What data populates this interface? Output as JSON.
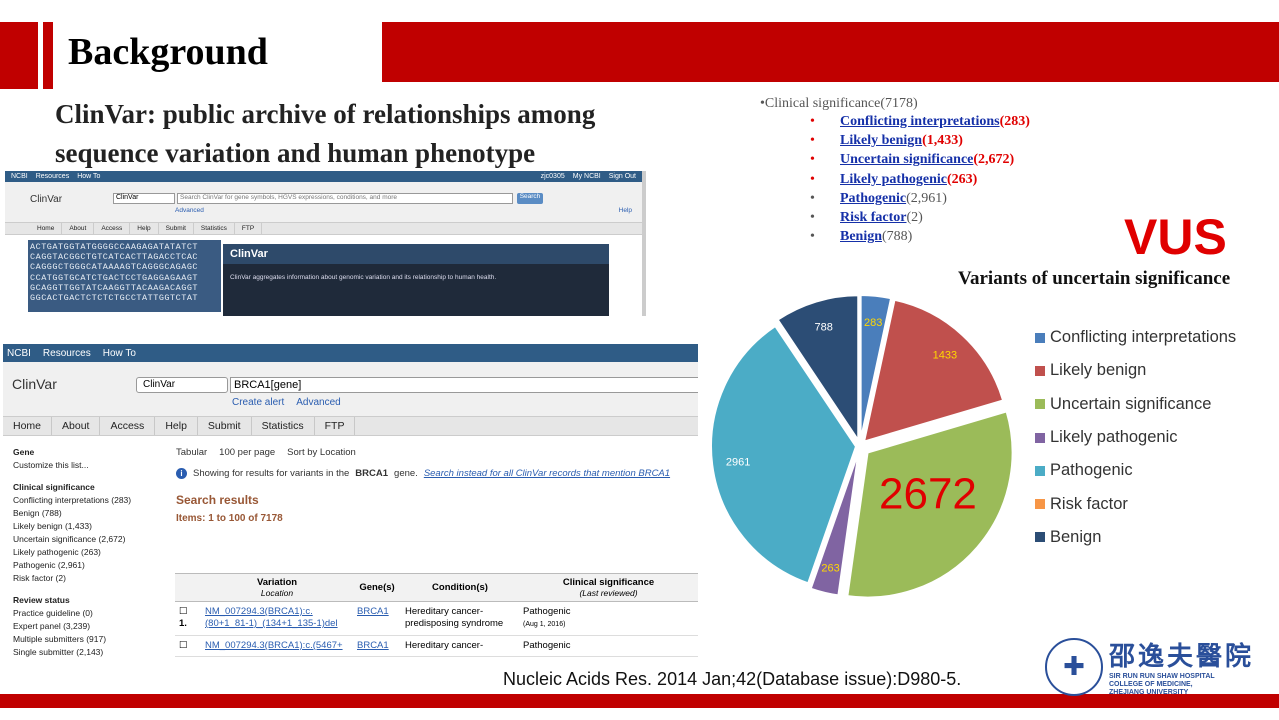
{
  "slide": {
    "title": "Background",
    "subtitle_line1": "ClinVar: public archive of relationships among",
    "subtitle_line2": "sequence variation and human phenotype",
    "citation": "Nucleic Acids Res. 2014 Jan;42(Database issue):D980-5."
  },
  "shot1": {
    "top_left": [
      "NCBI",
      "Resources",
      "How To"
    ],
    "top_right": [
      "zjc0305",
      "My NCBI",
      "Sign Out"
    ],
    "brand": "ClinVar",
    "db_select": "ClinVar",
    "search_placeholder": "Search ClinVar for gene symbols, HGVS expressions, conditions, and more",
    "search_button": "Search",
    "advanced": "Advanced",
    "help": "Help",
    "nav": [
      "Home",
      "About",
      "Access",
      "Help",
      "Submit",
      "Statistics",
      "FTP"
    ],
    "dna_lines": [
      "ACTGATGGTATGGGGCCAAGAGATATATCT",
      "CAGGTACGGCTGTCATCACTTAGACCTCAC",
      "CAGGGCTGGGCATAAAAGTCAGGGCAGAGC",
      "CCATGGTGCATCTGACTCCTGAGGAGAAGT",
      "GCAGGTTGGTATCAAGGTTACAAGACAGGT",
      "GGCACTGACTCTCTCTGCCTATTGGTCTAT"
    ],
    "box_title": "ClinVar",
    "box_desc": "ClinVar aggregates information about genomic variation and its relationship to human health."
  },
  "shot2": {
    "top": [
      "NCBI",
      "Resources",
      "How To"
    ],
    "brand": "ClinVar",
    "db_select": "ClinVar",
    "search_value": "BRCA1[gene]",
    "create_alert": "Create alert",
    "advanced": "Advanced",
    "nav": [
      "Home",
      "About",
      "Access",
      "Help",
      "Submit",
      "Statistics",
      "FTP"
    ],
    "side": {
      "gene_head": "Gene",
      "gene_items": [
        "Customize this list..."
      ],
      "clin_head": "Clinical significance",
      "clin_items": [
        "Conflicting interpretations (283)",
        "Benign (788)",
        "Likely benign (1,433)",
        "Uncertain significance (2,672)",
        "Likely pathogenic (263)",
        "Pathogenic (2,961)",
        "Risk factor (2)"
      ],
      "review_head": "Review status",
      "review_items": [
        "Practice guideline (0)",
        "Expert panel (3,239)",
        "Multiple submitters (917)",
        "Single submitter (2,143)"
      ]
    },
    "opts": [
      "Tabular",
      "100 per page",
      "Sort by Location"
    ],
    "info_text": "Showing for results for variants in the",
    "info_gene": "BRCA1",
    "info_text2": "gene.",
    "info_alt": "Search instead for all ClinVar records that mention BRCA1",
    "results_title": "Search results",
    "results_count": "Items: 1 to 100 of 7178",
    "table": {
      "h_variation": "Variation",
      "h_location": "Location",
      "h_gene": "Gene(s)",
      "h_condition": "Condition(s)",
      "h_clinsig": "Clinical significance",
      "h_reviewed": "(Last reviewed)",
      "rows": [
        {
          "num": "1.",
          "variation": "NM_007294.3(BRCA1):c.(80+1_81-1)_(134+1_135-1)del",
          "gene": "BRCA1",
          "condition": "Hereditary cancer-predisposing syndrome",
          "sig": "Pathogenic",
          "date": "(Aug 1, 2016)"
        },
        {
          "num": "",
          "variation": "NM_007294.3(BRCA1):c.(5467+",
          "gene": "BRCA1",
          "condition": "Hereditary cancer-",
          "sig": "Pathogenic",
          "date": ""
        }
      ]
    }
  },
  "sig_list": {
    "head": "•Clinical significance(7178)",
    "items": [
      {
        "name": "Conflicting interpretations",
        "count": "(283)",
        "style": "red"
      },
      {
        "name": "Likely benign",
        "count": "(1,433)",
        "style": "red"
      },
      {
        "name": "Uncertain significance",
        "count": "(2,672)",
        "style": "red"
      },
      {
        "name": "Likely pathogenic",
        "count": "(263)",
        "style": "red"
      },
      {
        "name": "Pathogenic",
        "count": "(2,961)",
        "style": "gray"
      },
      {
        "name": "Risk factor",
        "count": "(2)",
        "style": "gray"
      },
      {
        "name": "Benign",
        "count": "(788)",
        "style": "gray"
      }
    ]
  },
  "vus": "VUS",
  "vus_sub": "Variants of uncertain significance",
  "chart_data": {
    "type": "pie",
    "categories": [
      "Conflicting interpretations",
      "Likely benign",
      "Uncertain significance",
      "Likely pathogenic",
      "Pathogenic",
      "Risk factor",
      "Benign"
    ],
    "values": [
      283,
      1433,
      2672,
      263,
      2961,
      2,
      788
    ],
    "labels": [
      "283",
      "1433",
      "2672",
      "263",
      "2961",
      "2",
      "788"
    ],
    "colors": [
      "#4a7ebb",
      "#c0504d",
      "#9bbb59",
      "#8064a2",
      "#4bacc6",
      "#f79646",
      "#2c4d75"
    ],
    "exploded": true,
    "legend_position": "right"
  },
  "logo": {
    "cn": "邵逸夫醫院",
    "en1": "SIR RUN RUN SHAW HOSPITAL",
    "en2": "COLLEGE OF MEDICINE,",
    "en3": "ZHEJIANG UNIVERSITY"
  }
}
